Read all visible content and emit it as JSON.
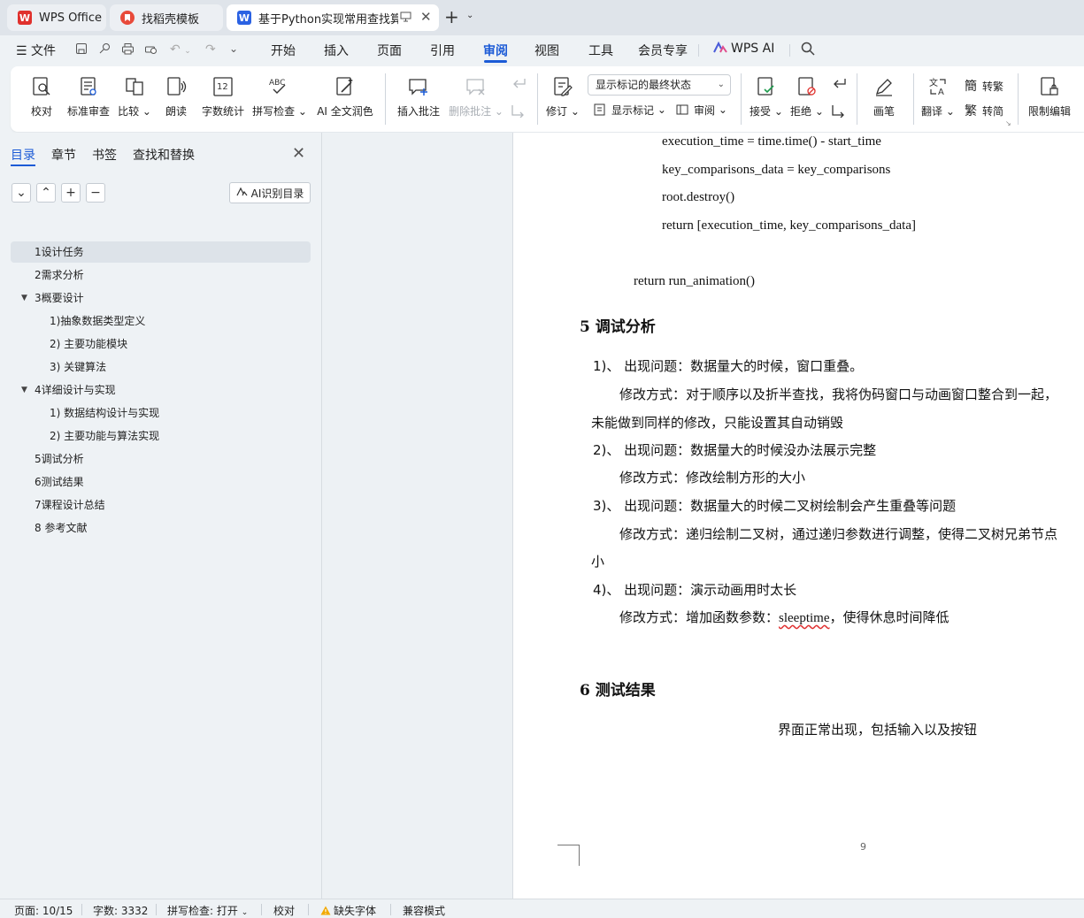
{
  "tabs": [
    {
      "label": "WPS Office",
      "logo": "W"
    },
    {
      "label": "找稻壳模板"
    },
    {
      "label": "基于Python实现常用查找算法",
      "logo": "W"
    }
  ],
  "menu": {
    "file": "文件",
    "items": [
      "开始",
      "插入",
      "页面",
      "引用",
      "审阅",
      "视图",
      "工具",
      "会员专享",
      "WPS AI"
    ],
    "active": "审阅"
  },
  "ribbon": {
    "proofread": "校对",
    "standard_review": "标准审查",
    "compare": "比较",
    "read_aloud": "朗读",
    "word_count": "字数统计",
    "spell_check": "拼写检查",
    "ai_polish": "AI 全文润色",
    "insert_comment": "插入批注",
    "delete_comment": "删除批注",
    "track_changes": "修订",
    "markup_mode": "显示标记的最终状态",
    "show_markup": "显示标记",
    "review": "审阅",
    "accept": "接受",
    "reject": "拒绝",
    "pen": "画笔",
    "translate": "翻译",
    "to_traditional": "转繁",
    "to_simplified": "转简",
    "restrict_edit": "限制编辑"
  },
  "nav": {
    "tabs": [
      "目录",
      "章节",
      "书签",
      "查找和替换"
    ],
    "ai_toc": "AI识别目录",
    "toc": [
      {
        "label": "1设计任务",
        "level": 1,
        "selected": true
      },
      {
        "label": "2需求分析",
        "level": 1
      },
      {
        "label": "3概要设计",
        "level": 1,
        "expanded": true
      },
      {
        "label": "1)抽象数据类型定义",
        "level": 2
      },
      {
        "label": "2) 主要功能模块",
        "level": 2
      },
      {
        "label": "3) 关键算法",
        "level": 2
      },
      {
        "label": "4详细设计与实现",
        "level": 1,
        "expanded": true
      },
      {
        "label": "1) 数据结构设计与实现",
        "level": 2
      },
      {
        "label": "2) 主要功能与算法实现",
        "level": 2
      },
      {
        "label": "5调试分析",
        "level": 1
      },
      {
        "label": "6测试结果",
        "level": 1
      },
      {
        "label": "7课程设计总结",
        "level": 1
      },
      {
        "label": "8 参考文献",
        "level": 1
      }
    ]
  },
  "doc": {
    "code": [
      "execution_time = time.time() - start_time",
      "key_comparisons_data = key_comparisons",
      "root.destroy()",
      "return [execution_time, key_comparisons_data]"
    ],
    "code_return": "return run_animation()",
    "h5": "5  调试分析",
    "p1": "1)、  出现问题：数据量大的时候，窗口重叠。",
    "p1_fix": "修改方式：对于顺序以及折半查找，我将伪码窗口与动画窗口整合到一起，",
    "p1_fix2": "未能做到同样的修改，只能设置其自动销毁",
    "p2": "2)、  出现问题：数据量大的时候没办法展示完整",
    "p2_fix": "修改方式：修改绘制方形的大小",
    "p3": "3)、  出现问题：数据量大的时候二叉树绘制会产生重叠等问题",
    "p3_fix": "修改方式：递归绘制二叉树，通过递归参数进行调整，使得二叉树兄弟节点",
    "p3_fix2": "小",
    "p4": "4)、  出现问题：演示动画用时太长",
    "p4_fix_a": "修改方式：增加函数参数：",
    "p4_fix_word": "sleeptime",
    "p4_fix_b": "，使得休息时间降低",
    "h6": "6  测试结果",
    "p6": "界面正常出现，包括输入以及按钮",
    "page_number": "9"
  },
  "status": {
    "page": "页面: 10/15",
    "words": "字数: 3332",
    "spell": "拼写检查: 打开",
    "proof": "校对",
    "missing_font": "缺失字体",
    "compat": "兼容模式"
  },
  "colors": {
    "accent": "#1c5bd6",
    "wps_red": "#e0312d",
    "doc_blue": "#2b62e3"
  }
}
